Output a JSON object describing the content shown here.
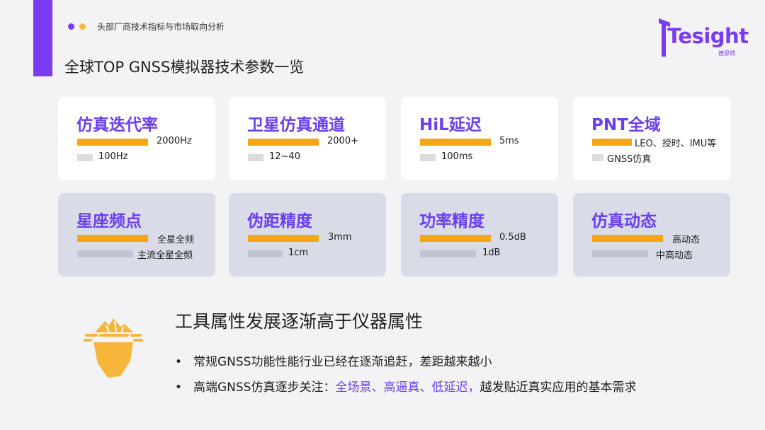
{
  "header": {
    "subtitle": "头部厂商技术指标与市场取向分析",
    "title": "全球TOP GNSS模拟器技术参数一览"
  },
  "logo": {
    "text": "Tesight",
    "cn": "德思特"
  },
  "colors": {
    "accent": "#7a3cf2",
    "highlight": "#f5a712",
    "muted": "#c1c4d3"
  },
  "cards": [
    {
      "title": "仿真迭代率",
      "top_value": "2000Hz",
      "bottom_value": "100Hz"
    },
    {
      "title": "卫星仿真通道",
      "top_value": "2000+",
      "bottom_value": "12~40"
    },
    {
      "title": "HiL延迟",
      "top_value": "5ms",
      "bottom_value": "100ms"
    },
    {
      "title": "PNT全域",
      "top_value": "LEO、授时、IMU等",
      "bottom_value": "GNSS仿真"
    },
    {
      "title": "星座频点",
      "top_value": "全星全频",
      "bottom_value": "主流全星全频"
    },
    {
      "title": "伪距精度",
      "top_value": "3mm",
      "bottom_value": "1cm"
    },
    {
      "title": "功率精度",
      "top_value": "0.5dB",
      "bottom_value": "1dB"
    },
    {
      "title": "仿真动态",
      "top_value": "高动态",
      "bottom_value": "中高动态"
    }
  ],
  "summary": {
    "icon": "iceberg-icon",
    "title": "工具属性发展逐渐高于仪器属性",
    "bullet_char": "•",
    "bullet1": "常规GNSS功能性能行业已经在逐渐追赶，差距越来越小",
    "bullet2_prefix": "高端GNSS仿真逐步关注：",
    "bullet2_highlight": "全场景、高逼真、低延迟，",
    "bullet2_suffix": "越发贴近真实应用的基本需求"
  }
}
